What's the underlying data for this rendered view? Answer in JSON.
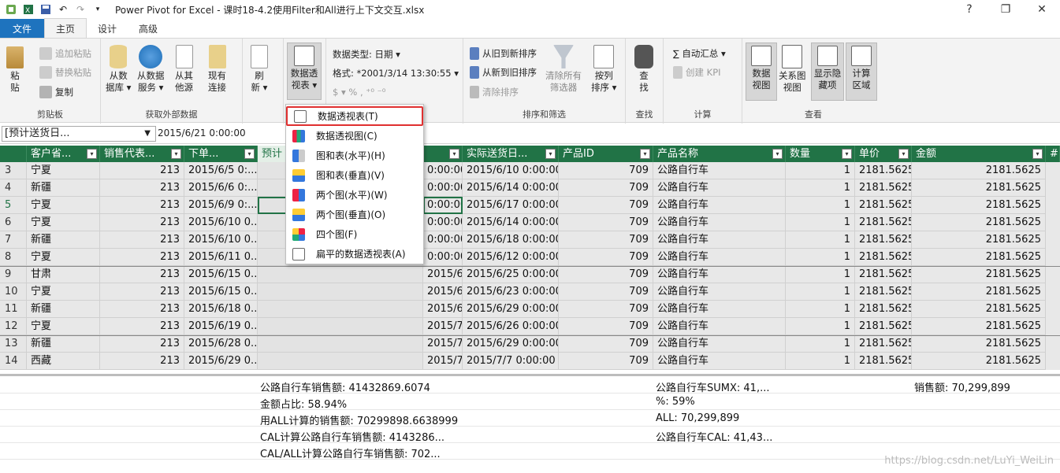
{
  "title": "Power Pivot for Excel - 课时18-4.2使用Filter和All进行上下文交互.xlsx",
  "window_controls": {
    "help": "?",
    "restore": "❐",
    "close": "✕"
  },
  "tabs": [
    {
      "label": "文件"
    },
    {
      "label": "主页"
    },
    {
      "label": "设计"
    },
    {
      "label": "高级"
    }
  ],
  "ribbon": {
    "clipboard": {
      "label": "剪贴板",
      "paste": "粘\n贴",
      "append_paste": "追加粘贴",
      "replace_paste": "替换粘贴",
      "copy": "复制"
    },
    "external": {
      "label": "获取外部数据",
      "from_db": "从数\n据库 ▾",
      "from_service": "从数据\n服务 ▾",
      "from_other": "从其\n他源",
      "existing": "现有\n连接"
    },
    "refresh": "刷\n新 ▾",
    "pivot": "数据透\n视表 ▾",
    "format": {
      "data_type": "数据类型: 日期 ▾",
      "format": "格式: *2001/3/14 13:30:55 ▾",
      "symbols": "$ ▾  %  ,  ⁺⁰  ⁻⁰"
    },
    "sort": {
      "label": "排序和筛选",
      "old_new": "从旧到新排序",
      "new_old": "从新到旧排序",
      "clear_sort": "清除排序",
      "clear_filters": "清除所有\n筛选器",
      "sort_by_col": "按列\n排序 ▾"
    },
    "find": {
      "label": "查找",
      "btn": "查\n找"
    },
    "calc": {
      "label": "计算",
      "autosum": "∑ 自动汇总 ▾",
      "kpi": "创建 KPI"
    },
    "view": {
      "label": "查看",
      "data_view": "数据\n视图",
      "diagram_view": "关系图\n视图",
      "show_hidden": "显示隐\n藏项",
      "calc_area": "计算\n区域"
    }
  },
  "namebox": "[预计送货日...",
  "formula_value": "2015/6/21 0:00:00",
  "columns": [
    "客户省...",
    "销售代表...",
    "下单...",
    "预计",
    "",
    "实际送货日...",
    "产品ID",
    "产品名称",
    "数量",
    "单价",
    "金额",
    "#"
  ],
  "rows": [
    {
      "n": "3",
      "c": [
        "宁夏",
        "213",
        "2015/6/5 0:...",
        "",
        "0:00:00",
        "2015/6/10 0:00:00",
        "709",
        "公路自行车",
        "1",
        "2181.5625",
        "2181.5625"
      ]
    },
    {
      "n": "4",
      "c": [
        "新疆",
        "213",
        "2015/6/6 0:...",
        "",
        "0:00:00",
        "2015/6/14 0:00:00",
        "709",
        "公路自行车",
        "1",
        "2181.5625",
        "2181.5625"
      ]
    },
    {
      "n": "5",
      "c": [
        "宁夏",
        "213",
        "2015/6/9 0:...",
        "",
        "0:00:00",
        "2015/6/17 0:00:00",
        "709",
        "公路自行车",
        "1",
        "2181.5625",
        "2181.5625"
      ]
    },
    {
      "n": "6",
      "c": [
        "宁夏",
        "213",
        "2015/6/10 0...",
        "",
        "0:00:00",
        "2015/6/14 0:00:00",
        "709",
        "公路自行车",
        "1",
        "2181.5625",
        "2181.5625"
      ]
    },
    {
      "n": "7",
      "c": [
        "新疆",
        "213",
        "2015/6/10 0...",
        "",
        "0:00:00",
        "2015/6/18 0:00:00",
        "709",
        "公路自行车",
        "1",
        "2181.5625",
        "2181.5625"
      ]
    },
    {
      "n": "8",
      "c": [
        "宁夏",
        "213",
        "2015/6/11 0...",
        "",
        "0:00:00",
        "2015/6/12 0:00:00",
        "709",
        "公路自行车",
        "1",
        "2181.5625",
        "2181.5625"
      ]
    },
    {
      "n": "9",
      "c": [
        "甘肃",
        "213",
        "2015/6/15 0...",
        "",
        "2015/6/27 0:00:00",
        "2015/6/25 0:00:00",
        "709",
        "公路自行车",
        "1",
        "2181.5625",
        "2181.5625"
      ]
    },
    {
      "n": "10",
      "c": [
        "宁夏",
        "213",
        "2015/6/15 0...",
        "",
        "2015/6/27 0:00:00",
        "2015/6/23 0:00:00",
        "709",
        "公路自行车",
        "1",
        "2181.5625",
        "2181.5625"
      ]
    },
    {
      "n": "11",
      "c": [
        "新疆",
        "213",
        "2015/6/18 0...",
        "",
        "2015/6/30 0:00:00",
        "2015/6/29 0:00:00",
        "709",
        "公路自行车",
        "1",
        "2181.5625",
        "2181.5625"
      ]
    },
    {
      "n": "12",
      "c": [
        "宁夏",
        "213",
        "2015/6/19 0...",
        "",
        "2015/7/1 0:00:00",
        "2015/6/26 0:00:00",
        "709",
        "公路自行车",
        "1",
        "2181.5625",
        "2181.5625"
      ]
    },
    {
      "n": "13",
      "c": [
        "新疆",
        "213",
        "2015/6/28 0...",
        "",
        "2015/7/10 0:00:00",
        "2015/6/29 0:00:00",
        "709",
        "公路自行车",
        "1",
        "2181.5625",
        "2181.5625"
      ]
    },
    {
      "n": "14",
      "c": [
        "西藏",
        "213",
        "2015/6/29 0...",
        "",
        "2015/7/11 0:00:00",
        "2015/7/7 0:00:00",
        "709",
        "公路自行车",
        "1",
        "2181.5625",
        "2181.5625"
      ]
    }
  ],
  "measures": {
    "m1": "公路自行车销售额: 41432869.6074",
    "m2": "金额占比: 58.94%",
    "m3": "用ALL计算的销售额: 70299898.6638999",
    "m4": "CAL计算公路自行车销售额: 4143286...",
    "m5": "CAL/ALL计算公路自行车销售额: 702...",
    "p1": "公路自行车SUMX: 41,...",
    "p2": "%: 59%",
    "p3": "ALL: 70,299,899",
    "p4": "公路自行车CAL: 41,43...",
    "s1": "销售额: 70,299,899"
  },
  "menu": [
    {
      "label": "数据透视表(T)"
    },
    {
      "label": "数据透视图(C)"
    },
    {
      "label": "图和表(水平)(H)"
    },
    {
      "label": "图和表(垂直)(V)"
    },
    {
      "label": "两个图(水平)(W)"
    },
    {
      "label": "两个图(垂直)(O)"
    },
    {
      "label": "四个图(F)"
    },
    {
      "label": "扁平的数据透视表(A)"
    }
  ],
  "watermark": "https://blog.csdn.net/LuYi_WeiLin",
  "colors": {
    "accent": "#217346",
    "file_tab": "#1e73be",
    "highlight": "#e03030"
  }
}
